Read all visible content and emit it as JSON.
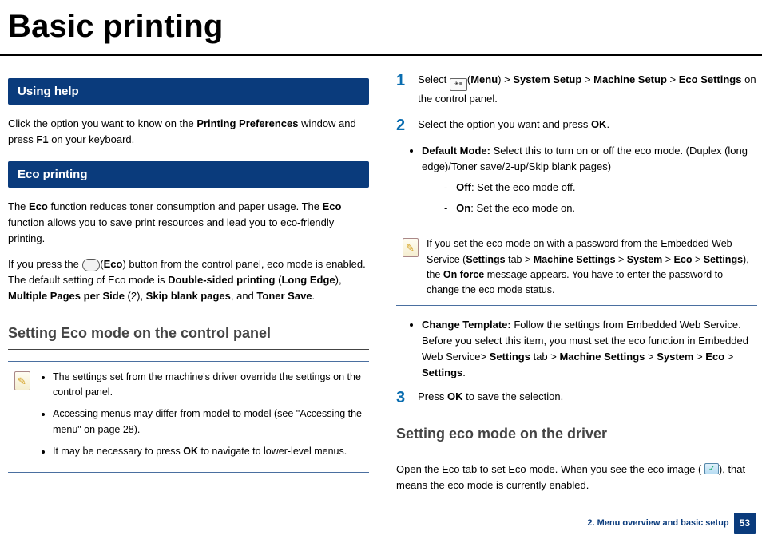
{
  "title": "Basic printing",
  "left": {
    "help_heading": "Using help",
    "help_p_a": "Click the option you want to know on the ",
    "help_p_b": "Printing Preferences",
    "help_p_c": " window and press ",
    "help_p_d": "F1",
    "help_p_e": " on your keyboard.",
    "eco_heading": "Eco printing",
    "eco_p1_a": "The ",
    "eco_p1_b": "Eco",
    "eco_p1_c": " function reduces toner consumption and paper usage. The ",
    "eco_p1_d": "Eco",
    "eco_p1_e": " function allows you to save print resources and lead you to eco-friendly printing.",
    "eco_p2_pre": "If you press the ",
    "eco_p2_paren_open": "(",
    "eco_p2_eco": "Eco",
    "eco_p2_paren_close": ") ",
    "eco_p2_mid": "button from the control panel, eco mode is enabled. The default setting of Eco mode is ",
    "eco_p2_b1": "Double-sided printing",
    "eco_p2_paren": " (",
    "eco_p2_b2": "Long Edge",
    "eco_p2_close": "), ",
    "eco_p2_b3": "Multiple Pages per Side",
    "eco_p2_two": " (2), ",
    "eco_p2_b4": "Skip blank pages",
    "eco_p2_and": ", and ",
    "eco_p2_b5": "Toner Save",
    "eco_p2_end": ".",
    "subhead": "Setting Eco mode on the control panel",
    "note1_li1": "The settings set from the machine's driver override the settings on the control panel.",
    "note1_li2_a": "Accessing menus may differ from model to model (see \"Accessing the menu\" on page 28).",
    "note1_li3_a": "It may be necessary to press ",
    "note1_li3_ok": "OK",
    "note1_li3_b": " to navigate to lower-level menus."
  },
  "right": {
    "step1_num": "1",
    "step1_a": "Select ",
    "step1_menu": "Menu",
    "step1_sep": " > ",
    "step1_b1": "System Setup",
    "step1_b2": "Machine Setup",
    "step1_b3": "Eco Settings",
    "step1_tail": " on the control panel.",
    "step2_num": "2",
    "step2_text_a": "Select the option you want and press ",
    "step2_ok": "OK",
    "step2_dot": ".",
    "bul_dm_label": "Default Mode:",
    "bul_dm_text": " Select this to turn on or off the eco mode. (Duplex (long edge)/Toner save/2-up/Skip blank pages)",
    "off_label": "Off",
    "off_text": ": Set the eco mode off.",
    "on_label": "On",
    "on_text": ": Set the eco mode on.",
    "note2_a": "If you set the eco mode on with a password from the Embedded Web Service (",
    "note2_b1": "Settings",
    "note2_tab": " tab > ",
    "note2_b2": "Machine Settings",
    "note2_gt": " > ",
    "note2_b3": "System",
    "note2_b4": "Eco",
    "note2_b5": "Settings",
    "note2_mid": "), the ",
    "note2_force": "On force",
    "note2_end": " message appears. You have to enter the password to change the eco mode status.",
    "bul_ct_label": "Change Template:",
    "bul_ct_text": " Follow the settings from Embedded Web Service. Before you select this item, you must set the eco function in Embedded Web Service> ",
    "ct_b1": "Settings",
    "ct_tab": " tab > ",
    "ct_b2": "Machine Settings",
    "ct_b3": "System",
    "ct_b4": "Eco",
    "ct_b5": "Settings",
    "ct_dot": ".",
    "step3_num": "3",
    "step3_a": "Press ",
    "step3_ok": "OK",
    "step3_b": " to save the selection.",
    "subhead2": "Setting eco mode on the driver",
    "driver_p_a": "Open the Eco tab to set Eco mode. When you see the eco image ( ",
    "driver_p_b": "), that means the eco mode is currently enabled.",
    "footer_text": "2. Menu overview and basic setup",
    "page": "53"
  }
}
